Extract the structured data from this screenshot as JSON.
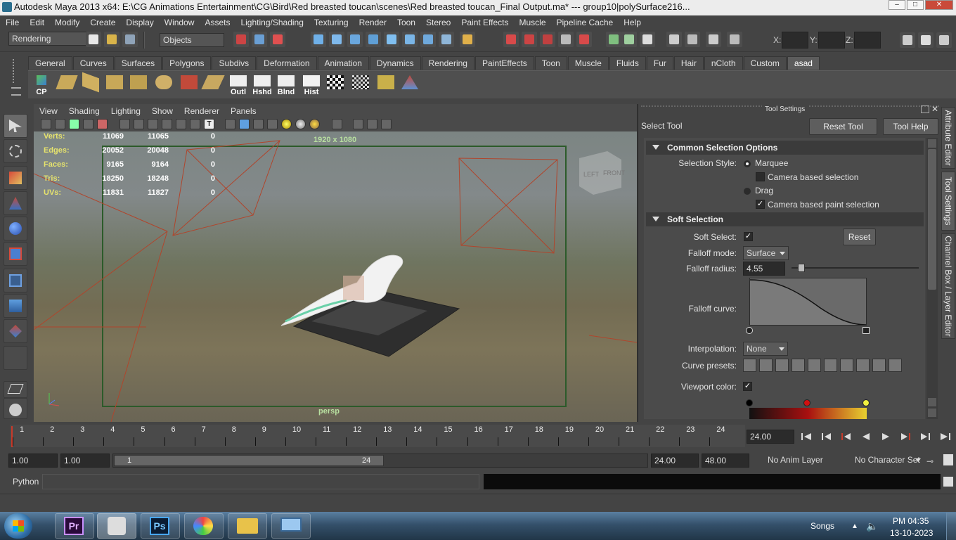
{
  "window": {
    "title": "Autodesk Maya 2013 x64: E:\\CG Animations Entertainment\\CG\\Bird\\Red breasted toucan\\scenes\\Red breasted toucan_Final Output.ma*   ---   group10|polySurface216..."
  },
  "menus": [
    "File",
    "Edit",
    "Modify",
    "Create",
    "Display",
    "Window",
    "Assets",
    "Lighting/Shading",
    "Texturing",
    "Render",
    "Toon",
    "Stereo",
    "Paint Effects",
    "Muscle",
    "Pipeline Cache",
    "Help"
  ],
  "status": {
    "menuset": "Rendering",
    "selection_mode": "Objects",
    "x_label": "X:",
    "y_label": "Y:",
    "z_label": "Z:"
  },
  "shelf": {
    "tabs": [
      "General",
      "Curves",
      "Surfaces",
      "Polygons",
      "Subdivs",
      "Deformation",
      "Animation",
      "Dynamics",
      "Rendering",
      "PaintEffects",
      "Toon",
      "Muscle",
      "Fluids",
      "Fur",
      "Hair",
      "nCloth",
      "Custom",
      "asad"
    ],
    "active_tab": "asad",
    "labels": {
      "cp": "CP",
      "outl": "Outl",
      "hshd": "Hshd",
      "blnd": "Blnd",
      "hist": "Hist"
    }
  },
  "viewport": {
    "menus": [
      "View",
      "Shading",
      "Lighting",
      "Show",
      "Renderer",
      "Panels"
    ],
    "resolution": "1920 x 1080",
    "camera": "persp",
    "hud": [
      {
        "label": "Verts:",
        "a": "11069",
        "b": "11065",
        "c": "0"
      },
      {
        "label": "Edges:",
        "a": "20052",
        "b": "20048",
        "c": "0"
      },
      {
        "label": "Faces:",
        "a": "9165",
        "b": "9164",
        "c": "0"
      },
      {
        "label": "Tris:",
        "a": "18250",
        "b": "18248",
        "c": "0"
      },
      {
        "label": "UVs:",
        "a": "11831",
        "b": "11827",
        "c": "0"
      }
    ],
    "cube_left": "LEFT",
    "cube_front": "FRONT"
  },
  "tool_settings": {
    "header": "Tool Settings",
    "tool_name": "Select Tool",
    "reset_tool": "Reset Tool",
    "tool_help": "Tool Help",
    "common": {
      "title": "Common Selection Options",
      "selection_style_label": "Selection Style:",
      "marquee": "Marquee",
      "camera_based": "Camera based selection",
      "drag": "Drag",
      "camera_based_paint": "Camera based paint selection"
    },
    "soft": {
      "title": "Soft Selection",
      "soft_select_label": "Soft Select:",
      "reset": "Reset",
      "falloff_mode_label": "Falloff mode:",
      "falloff_mode": "Surface",
      "falloff_radius_label": "Falloff radius:",
      "falloff_radius": "4.55",
      "falloff_radius_fraction": 0.05,
      "falloff_curve_label": "Falloff curve:",
      "interpolation_label": "Interpolation:",
      "interpolation": "None",
      "curve_presets_label": "Curve presets:",
      "viewport_color_label": "Viewport color:"
    }
  },
  "side_tabs": [
    "Attribute Editor",
    "Tool Settings",
    "Channel Box / Layer Editor"
  ],
  "timeline": {
    "ticks": [
      "1",
      "2",
      "3",
      "4",
      "5",
      "6",
      "7",
      "8",
      "9",
      "10",
      "11",
      "12",
      "13",
      "14",
      "15",
      "16",
      "17",
      "18",
      "19",
      "20",
      "21",
      "22",
      "23",
      "24"
    ],
    "current_time": "24.00"
  },
  "range": {
    "start": "1.00",
    "playback_start": "1.00",
    "slider_min": "1",
    "slider_max": "24",
    "playback_end": "24.00",
    "end": "48.00",
    "anim_layer": "No Anim Layer",
    "character_set": "No Character Set"
  },
  "cmd": {
    "language": "Python"
  },
  "taskbar": {
    "songs": "Songs",
    "time": "PM 04:35",
    "date": "13-10-2023",
    "apps": [
      "Pr",
      "Maya",
      "Ps",
      "Paint",
      "Explorer",
      "Computer"
    ]
  },
  "colors": {
    "accent_red": "#c83a2a",
    "camera_frame": "#2c5b2a",
    "hud_yellow": "#e6e36d"
  }
}
